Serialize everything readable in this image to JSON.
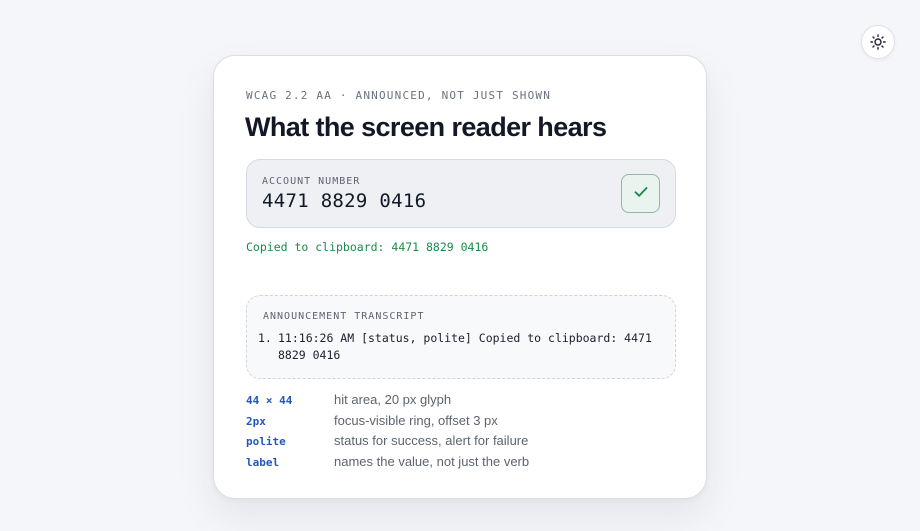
{
  "theme_toggle": {
    "icon": "sun-icon"
  },
  "card": {
    "eyebrow": "WCAG 2.2 AA · ANNOUNCED, NOT JUST SHOWN",
    "title": "What the screen reader hears",
    "field": {
      "label": "ACCOUNT NUMBER",
      "value": "4471 8829 0416",
      "copy_button_icon": "checkmark-icon"
    },
    "status_message": "Copied to clipboard: 4471 8829 0416",
    "transcript": {
      "label": "ANNOUNCEMENT TRANSCRIPT",
      "items": [
        {
          "num": "1.",
          "text": "11:16:26 AM [status, polite] Copied to clipboard: 4471 8829 0416"
        }
      ]
    },
    "specs": [
      {
        "key": "44 × 44",
        "desc": "hit area, 20 px glyph"
      },
      {
        "key": "2px",
        "desc": "focus-visible ring, offset 3 px"
      },
      {
        "key": "polite",
        "desc": "status for success, alert for failure"
      },
      {
        "key": "label",
        "desc": "names the value, not just the verb"
      }
    ]
  },
  "colors": {
    "background": "#f5f6f9",
    "success_green": "#1a8a4a",
    "spec_key_blue": "#2557b8",
    "title": "#121826"
  }
}
